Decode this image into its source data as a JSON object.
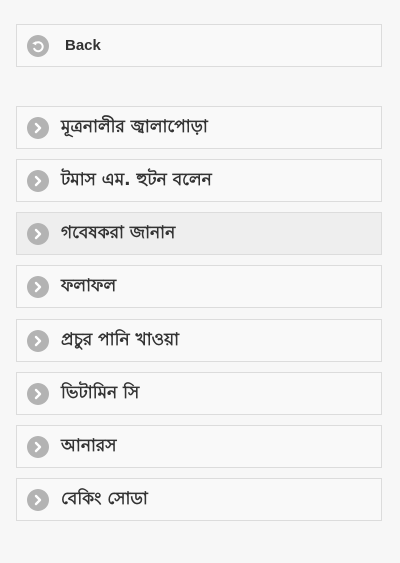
{
  "back": {
    "label": "Back",
    "icon": "back-arrow-icon"
  },
  "menu": {
    "items": [
      {
        "label": "মূত্রনালীর জ্বালাপোড়া",
        "icon": "chevron-right-icon",
        "active": false
      },
      {
        "label": "টমাস এম. হুটন বলেন",
        "icon": "chevron-right-icon",
        "active": false
      },
      {
        "label": "গবেষকরা জানান",
        "icon": "chevron-right-icon",
        "active": true
      },
      {
        "label": "ফলাফল",
        "icon": "chevron-right-icon",
        "active": false
      },
      {
        "label": "প্রচুর পানি খাওয়া",
        "icon": "chevron-right-icon",
        "active": false
      },
      {
        "label": "ভিটামিন সি",
        "icon": "chevron-right-icon",
        "active": false
      },
      {
        "label": "আনারস",
        "icon": "chevron-right-icon",
        "active": false
      },
      {
        "label": "বেকিং সোডা",
        "icon": "chevron-right-icon",
        "active": false
      }
    ]
  }
}
